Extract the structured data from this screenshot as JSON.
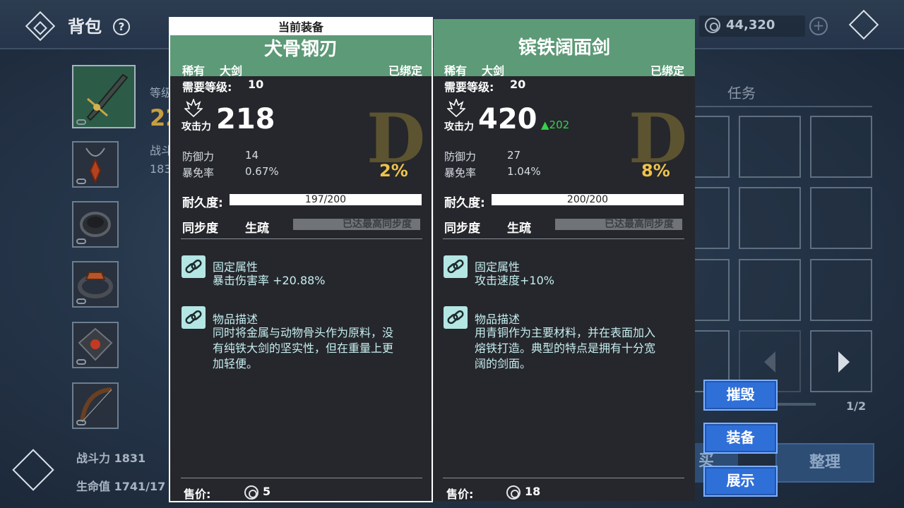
{
  "header": {
    "title": "背包",
    "help_glyph": "?",
    "currency": "44,320",
    "plus_glyph": "+"
  },
  "left": {
    "level_label_frag": "等级",
    "big_number_frag": "22",
    "power_label_frag": "战斗力",
    "power_num_frag": "183",
    "power_stat": "战斗力 1831",
    "hp_stat": "生命值 1741/17"
  },
  "right_panel": {
    "tab_task": "任务",
    "page_indicator": "1/2",
    "buy_btn_frag": "买",
    "sort_btn": "整理"
  },
  "current_equipped_label": "当前装备",
  "cards": [
    {
      "name": "犬骨钢刃",
      "rarity": "稀有",
      "type": "大剑",
      "bound": "已绑定",
      "req_label": "需要等级:",
      "req_level": "10",
      "atk_label": "攻击力",
      "atk_value": "218",
      "atk_delta": "",
      "grade": "D",
      "grade_pct": "2%",
      "stats": [
        {
          "label": "防御力",
          "value": "14"
        },
        {
          "label": "暴免率",
          "value": "0.67%"
        }
      ],
      "durability_label": "耐久度:",
      "durability": "197/200",
      "durability_frac": 0.985,
      "sync_label": "同步度",
      "sync_state": "生疏",
      "sync_bar_text": "已达最高同步度",
      "fixed_attr_title": "固定属性",
      "fixed_attr": "暴击伤害率 +20.88%",
      "desc_title": "物品描述",
      "desc_lines": [
        "同时将金属与动物骨头作为原料，没",
        "有纯铁大剑的坚实性，但在重量上更",
        "加轻便。"
      ],
      "price_label": "售价:",
      "price": "5"
    },
    {
      "name": "镔铁阔面剑",
      "rarity": "稀有",
      "type": "大剑",
      "bound": "已绑定",
      "req_label": "需要等级:",
      "req_level": "20",
      "atk_label": "攻击力",
      "atk_value": "420",
      "atk_delta": "▲202",
      "grade": "D",
      "grade_pct": "8%",
      "stats": [
        {
          "label": "防御力",
          "value": "27"
        },
        {
          "label": "暴免率",
          "value": "1.04%"
        }
      ],
      "durability_label": "耐久度:",
      "durability": "200/200",
      "durability_frac": 1.0,
      "sync_label": "同步度",
      "sync_state": "生疏",
      "sync_bar_text": "已达最高同步度",
      "fixed_attr_title": "固定属性",
      "fixed_attr": "攻击速度+10%",
      "desc_title": "物品描述",
      "desc_lines": [
        "用青铜作为主要材料，并在表面加入",
        "熔铁打造。典型的特点是拥有十分宽",
        "阔的剑面。"
      ],
      "price_label": "售价:",
      "price": "18"
    }
  ],
  "actions": {
    "destroy": "摧毁",
    "equip": "装备",
    "show": "展示"
  },
  "colors": {
    "card_header_green": "#5d9a77",
    "card_body": "#25272c",
    "grade_pct": "#efc34a",
    "atk_delta_green": "#35d24a",
    "action_blue": "#2f6fd8"
  }
}
